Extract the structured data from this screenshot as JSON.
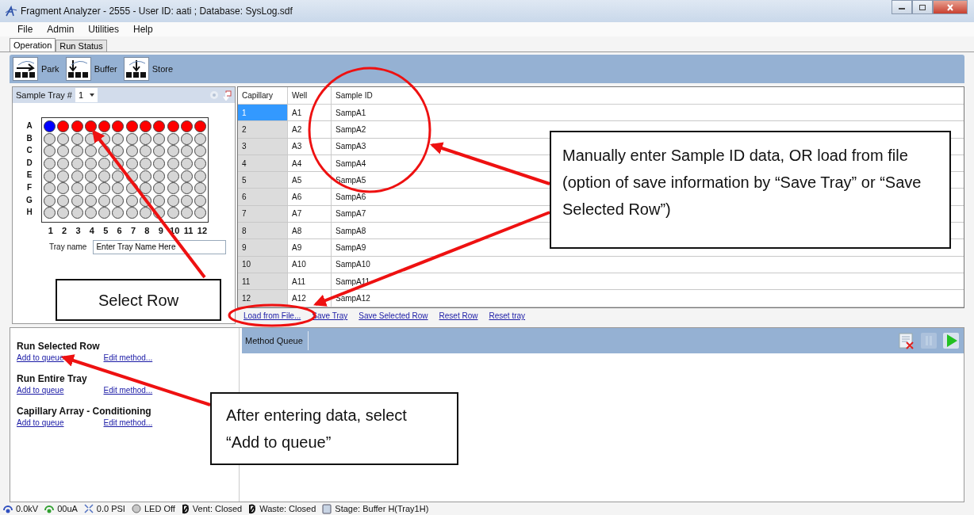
{
  "window": {
    "title": "Fragment Analyzer - 2555 - User ID: aati ; Database: SysLog.sdf"
  },
  "menu": [
    "File",
    "Admin",
    "Utilities",
    "Help"
  ],
  "tabs": [
    {
      "label": "Operation",
      "selected": true
    },
    {
      "label": "Run Status",
      "selected": false
    }
  ],
  "toolbar": [
    {
      "label": "Park",
      "kind": "park"
    },
    {
      "label": "Buffer",
      "kind": "buffer"
    },
    {
      "label": "Store",
      "kind": "store"
    }
  ],
  "tray": {
    "label": "Sample Tray #",
    "number": "1",
    "columns": [
      "1",
      "2",
      "3",
      "4",
      "5",
      "6",
      "7",
      "8",
      "9",
      "10",
      "11",
      "12"
    ],
    "rows": [
      {
        "label": "A",
        "wells": [
          {
            "color": "#0000ff"
          },
          {
            "color": "#ff0000"
          },
          {
            "color": "#ff0000"
          },
          {
            "color": "#ff0000"
          },
          {
            "color": "#ff0000"
          },
          {
            "color": "#ff0000"
          },
          {
            "color": "#ff0000"
          },
          {
            "color": "#ff0000"
          },
          {
            "color": "#ff0000"
          },
          {
            "color": "#ff0000"
          },
          {
            "color": "#ff0000"
          },
          {
            "color": "#ff0000"
          }
        ]
      },
      {
        "label": "B",
        "wells": [
          {
            "color": "#d6d6d6"
          },
          {
            "color": "#d6d6d6"
          },
          {
            "color": "#d6d6d6"
          },
          {
            "color": "#d6d6d6"
          },
          {
            "color": "#d6d6d6"
          },
          {
            "color": "#d6d6d6"
          },
          {
            "color": "#d6d6d6"
          },
          {
            "color": "#d6d6d6"
          },
          {
            "color": "#d6d6d6"
          },
          {
            "color": "#d6d6d6"
          },
          {
            "color": "#d6d6d6"
          },
          {
            "color": "#d6d6d6"
          }
        ]
      },
      {
        "label": "C",
        "wells": [
          {
            "color": "#d6d6d6"
          },
          {
            "color": "#d6d6d6"
          },
          {
            "color": "#d6d6d6"
          },
          {
            "color": "#d6d6d6"
          },
          {
            "color": "#d6d6d6"
          },
          {
            "color": "#d6d6d6"
          },
          {
            "color": "#d6d6d6"
          },
          {
            "color": "#d6d6d6"
          },
          {
            "color": "#d6d6d6"
          },
          {
            "color": "#d6d6d6"
          },
          {
            "color": "#d6d6d6"
          },
          {
            "color": "#d6d6d6"
          }
        ]
      },
      {
        "label": "D",
        "wells": [
          {
            "color": "#d6d6d6"
          },
          {
            "color": "#d6d6d6"
          },
          {
            "color": "#d6d6d6"
          },
          {
            "color": "#d6d6d6"
          },
          {
            "color": "#d6d6d6"
          },
          {
            "color": "#d6d6d6"
          },
          {
            "color": "#d6d6d6"
          },
          {
            "color": "#d6d6d6"
          },
          {
            "color": "#d6d6d6"
          },
          {
            "color": "#d6d6d6"
          },
          {
            "color": "#d6d6d6"
          },
          {
            "color": "#d6d6d6"
          }
        ]
      },
      {
        "label": "E",
        "wells": [
          {
            "color": "#d6d6d6"
          },
          {
            "color": "#d6d6d6"
          },
          {
            "color": "#d6d6d6"
          },
          {
            "color": "#d6d6d6"
          },
          {
            "color": "#d6d6d6"
          },
          {
            "color": "#d6d6d6"
          },
          {
            "color": "#d6d6d6"
          },
          {
            "color": "#d6d6d6"
          },
          {
            "color": "#d6d6d6"
          },
          {
            "color": "#d6d6d6"
          },
          {
            "color": "#d6d6d6"
          },
          {
            "color": "#d6d6d6"
          }
        ]
      },
      {
        "label": "F",
        "wells": [
          {
            "color": "#d6d6d6"
          },
          {
            "color": "#d6d6d6"
          },
          {
            "color": "#d6d6d6"
          },
          {
            "color": "#d6d6d6"
          },
          {
            "color": "#d6d6d6"
          },
          {
            "color": "#d6d6d6"
          },
          {
            "color": "#d6d6d6"
          },
          {
            "color": "#d6d6d6"
          },
          {
            "color": "#d6d6d6"
          },
          {
            "color": "#d6d6d6"
          },
          {
            "color": "#d6d6d6"
          },
          {
            "color": "#d6d6d6"
          }
        ]
      },
      {
        "label": "G",
        "wells": [
          {
            "color": "#d6d6d6"
          },
          {
            "color": "#d6d6d6"
          },
          {
            "color": "#d6d6d6"
          },
          {
            "color": "#d6d6d6"
          },
          {
            "color": "#d6d6d6"
          },
          {
            "color": "#d6d6d6"
          },
          {
            "color": "#d6d6d6"
          },
          {
            "color": "#d6d6d6"
          },
          {
            "color": "#d6d6d6"
          },
          {
            "color": "#d6d6d6"
          },
          {
            "color": "#d6d6d6"
          },
          {
            "color": "#d6d6d6"
          }
        ]
      },
      {
        "label": "H",
        "wells": [
          {
            "color": "#d6d6d6"
          },
          {
            "color": "#d6d6d6"
          },
          {
            "color": "#d6d6d6"
          },
          {
            "color": "#d6d6d6"
          },
          {
            "color": "#d6d6d6"
          },
          {
            "color": "#d6d6d6"
          },
          {
            "color": "#d6d6d6"
          },
          {
            "color": "#d6d6d6"
          },
          {
            "color": "#d6d6d6"
          },
          {
            "color": "#d6d6d6"
          },
          {
            "color": "#d6d6d6"
          },
          {
            "color": "#d6d6d6"
          }
        ]
      }
    ],
    "name_label": "Tray name",
    "name_value": "Enter Tray Name Here"
  },
  "table": {
    "columns": [
      "Capillary",
      "Well",
      "Sample ID"
    ],
    "rows": [
      {
        "capillary": "1",
        "well": "A1",
        "sample_id": "SampA1",
        "selected": true
      },
      {
        "capillary": "2",
        "well": "A2",
        "sample_id": "SampA2",
        "selected": false
      },
      {
        "capillary": "3",
        "well": "A3",
        "sample_id": "SampA3",
        "selected": false
      },
      {
        "capillary": "4",
        "well": "A4",
        "sample_id": "SampA4",
        "selected": false
      },
      {
        "capillary": "5",
        "well": "A5",
        "sample_id": "SampA5",
        "selected": false
      },
      {
        "capillary": "6",
        "well": "A6",
        "sample_id": "SampA6",
        "selected": false
      },
      {
        "capillary": "7",
        "well": "A7",
        "sample_id": "SampA7",
        "selected": false
      },
      {
        "capillary": "8",
        "well": "A8",
        "sample_id": "SampA8",
        "selected": false
      },
      {
        "capillary": "9",
        "well": "A9",
        "sample_id": "SampA9",
        "selected": false
      },
      {
        "capillary": "10",
        "well": "A10",
        "sample_id": "SampA10",
        "selected": false
      },
      {
        "capillary": "11",
        "well": "A11",
        "sample_id": "SampA11",
        "selected": false
      },
      {
        "capillary": "12",
        "well": "A12",
        "sample_id": "SampA12",
        "selected": false
      }
    ],
    "links": [
      "Load from File...",
      "Save Tray",
      "Save Selected Row",
      "Reset Row",
      "Reset tray"
    ]
  },
  "methods": [
    {
      "title": "Run Selected Row",
      "links": [
        "Add to queue",
        "Edit method..."
      ]
    },
    {
      "title": "Run Entire Tray",
      "links": [
        "Add to queue",
        "Edit method..."
      ]
    },
    {
      "title": "Capillary Array - Conditioning",
      "links": [
        "Add to queue",
        "Edit method..."
      ]
    }
  ],
  "method_queue": {
    "label": "Method Queue",
    "buttons": [
      {
        "kind": "clear",
        "disabled": false
      },
      {
        "kind": "pause",
        "disabled": true
      },
      {
        "kind": "play",
        "disabled": false
      }
    ]
  },
  "status_bar": [
    {
      "kind": "voltage",
      "text": "0.0kV"
    },
    {
      "kind": "current",
      "text": "00uA"
    },
    {
      "kind": "pressure",
      "text": "0.0 PSI"
    },
    {
      "kind": "led",
      "text": "LED Off"
    },
    {
      "kind": "valve",
      "text": "Vent: Closed"
    },
    {
      "kind": "valve",
      "text": "Waste: Closed"
    },
    {
      "kind": "stage",
      "text": "Stage: Buffer H(Tray1H)"
    }
  ],
  "annotations": [
    {
      "kind": "data",
      "text": "Manually enter Sample ID data, OR load from file (option of save information by “Save Tray” or “Save Selected Row”)"
    },
    {
      "kind": "row",
      "text": "Select Row"
    },
    {
      "kind": "queue",
      "text": "After entering data, select “Add to queue”"
    }
  ]
}
